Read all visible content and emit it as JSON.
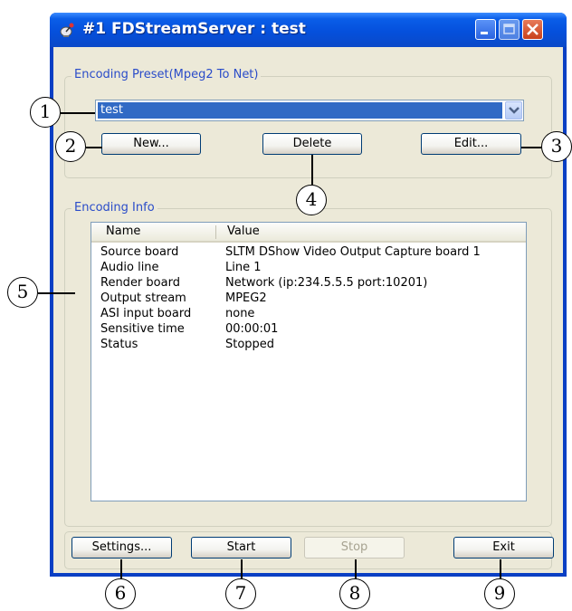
{
  "window": {
    "title": "#1 FDStreamServer : test",
    "icon": "satellite-dish-icon"
  },
  "preset_group": {
    "legend": "Encoding Preset(Mpeg2 To Net)",
    "selected_preset": "test",
    "new_label": "New...",
    "delete_label": "Delete",
    "edit_label": "Edit..."
  },
  "info_group": {
    "legend": "Encoding Info",
    "columns": [
      "Name",
      "Value"
    ],
    "rows": [
      {
        "name": "Source board",
        "value": "SLTM DShow  Video Output Capture board 1"
      },
      {
        "name": "Audio line",
        "value": "Line 1"
      },
      {
        "name": "Render board",
        "value": "Network (ip:234.5.5.5 port:10201)"
      },
      {
        "name": "Output stream",
        "value": "MPEG2"
      },
      {
        "name": "ASI input board",
        "value": "none"
      },
      {
        "name": "Sensitive time",
        "value": "00:00:01"
      },
      {
        "name": "Status",
        "value": "Stopped"
      }
    ]
  },
  "bottom_buttons": {
    "settings_label": "Settings...",
    "start_label": "Start",
    "stop_label": "Stop",
    "exit_label": "Exit"
  },
  "callouts": [
    "1",
    "2",
    "3",
    "4",
    "5",
    "6",
    "7",
    "8",
    "9"
  ],
  "colors": {
    "titlebar": "#0550dc",
    "selection": "#316ac5",
    "legend_text": "#2a4cc9",
    "close_button": "#c8401b"
  }
}
